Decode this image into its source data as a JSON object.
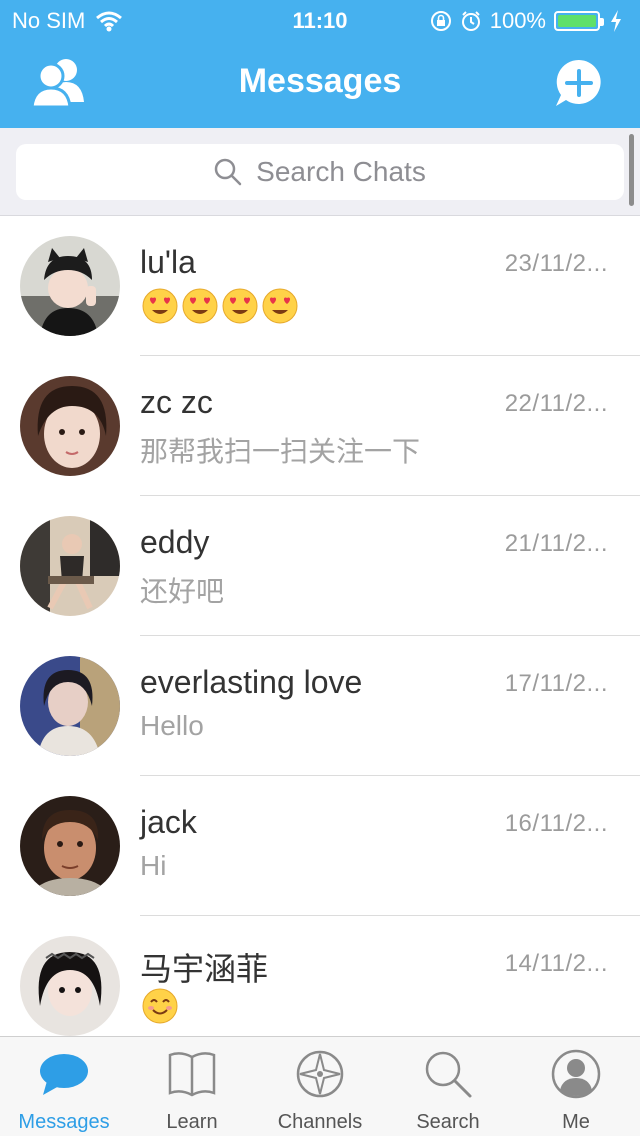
{
  "status_bar": {
    "carrier": "No SIM",
    "time": "11:10",
    "battery": "100%",
    "battery_level": 1.0
  },
  "nav": {
    "title": "Messages",
    "left_icon": "contacts-icon",
    "right_icon": "compose-plus-icon"
  },
  "search": {
    "placeholder": "Search Chats"
  },
  "chats": [
    {
      "name": "lu'la",
      "date": "23/11/2...",
      "message": "😍😍😍😍",
      "emoji_count": 4,
      "emoji": "heart-eyes"
    },
    {
      "name": "zc zc",
      "date": "22/11/2...",
      "message": "那帮我扫一扫关注一下"
    },
    {
      "name": "eddy",
      "date": "21/11/2...",
      "message": "还好吧"
    },
    {
      "name": "everlasting love",
      "date": "17/11/2...",
      "message": "Hello"
    },
    {
      "name": "jack",
      "date": "16/11/2...",
      "message": "Hi"
    },
    {
      "name": "马宇涵菲",
      "date": "14/11/2...",
      "message": "😊",
      "emoji_count": 1,
      "emoji": "smile"
    }
  ],
  "tabs": [
    {
      "label": "Messages",
      "icon": "chat-bubble-icon",
      "active": true
    },
    {
      "label": "Learn",
      "icon": "book-icon",
      "active": false
    },
    {
      "label": "Channels",
      "icon": "compass-icon",
      "active": false
    },
    {
      "label": "Search",
      "icon": "search-icon",
      "active": false
    },
    {
      "label": "Me",
      "icon": "person-icon",
      "active": false
    }
  ],
  "colors": {
    "accent": "#46b1ef",
    "active_tab": "#2e9ee6"
  }
}
